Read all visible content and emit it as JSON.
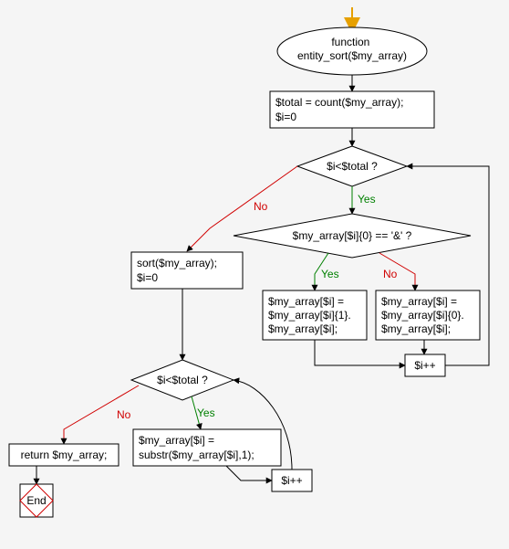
{
  "chart_data": {
    "type": "flowchart",
    "title": "",
    "nodes": [
      {
        "id": "start_arrow",
        "type": "start-arrow"
      },
      {
        "id": "func",
        "type": "terminator",
        "lines": [
          "function",
          "entity_sort($my_array)"
        ]
      },
      {
        "id": "init",
        "type": "process",
        "lines": [
          "$total = count($my_array);",
          "$i=0"
        ]
      },
      {
        "id": "cond1",
        "type": "decision",
        "lines": [
          "$i<$total ?"
        ]
      },
      {
        "id": "cond_amp",
        "type": "decision",
        "lines": [
          "$my_array[$i]{0} == '&' ?"
        ]
      },
      {
        "id": "amp_yes",
        "type": "process",
        "lines": [
          "$my_array[$i] =",
          "$my_array[$i]{1}.",
          "$my_array[$i];"
        ]
      },
      {
        "id": "amp_no",
        "type": "process",
        "lines": [
          "$my_array[$i] =",
          "$my_array[$i]{0}.",
          "$my_array[$i];"
        ]
      },
      {
        "id": "inc1",
        "type": "process",
        "lines": [
          "$i++"
        ]
      },
      {
        "id": "sortblk",
        "type": "process",
        "lines": [
          "sort($my_array);",
          "$i=0"
        ]
      },
      {
        "id": "cond2",
        "type": "decision",
        "lines": [
          "$i<$total ?"
        ]
      },
      {
        "id": "substr",
        "type": "process",
        "lines": [
          "$my_array[$i] =",
          "substr($my_array[$i],1);"
        ]
      },
      {
        "id": "inc2",
        "type": "process",
        "lines": [
          "$i++"
        ]
      },
      {
        "id": "ret",
        "type": "process",
        "lines": [
          "return $my_array;"
        ]
      },
      {
        "id": "end",
        "type": "terminator-end",
        "lines": [
          "End"
        ]
      }
    ],
    "edges": [
      {
        "from": "start_arrow",
        "to": "func"
      },
      {
        "from": "func",
        "to": "init"
      },
      {
        "from": "init",
        "to": "cond1"
      },
      {
        "from": "cond1",
        "to": "cond_amp",
        "label": "Yes"
      },
      {
        "from": "cond1",
        "to": "sortblk",
        "label": "No"
      },
      {
        "from": "cond_amp",
        "to": "amp_yes",
        "label": "Yes"
      },
      {
        "from": "cond_amp",
        "to": "amp_no",
        "label": "No"
      },
      {
        "from": "amp_yes",
        "to": "inc1"
      },
      {
        "from": "amp_no",
        "to": "inc1"
      },
      {
        "from": "inc1",
        "to": "cond1",
        "loop": true
      },
      {
        "from": "sortblk",
        "to": "cond2"
      },
      {
        "from": "cond2",
        "to": "substr",
        "label": "Yes"
      },
      {
        "from": "cond2",
        "to": "ret",
        "label": "No"
      },
      {
        "from": "substr",
        "to": "inc2"
      },
      {
        "from": "inc2",
        "to": "cond2",
        "loop": true
      },
      {
        "from": "ret",
        "to": "end"
      }
    ],
    "labels": {
      "yes": "Yes",
      "no": "No"
    }
  }
}
